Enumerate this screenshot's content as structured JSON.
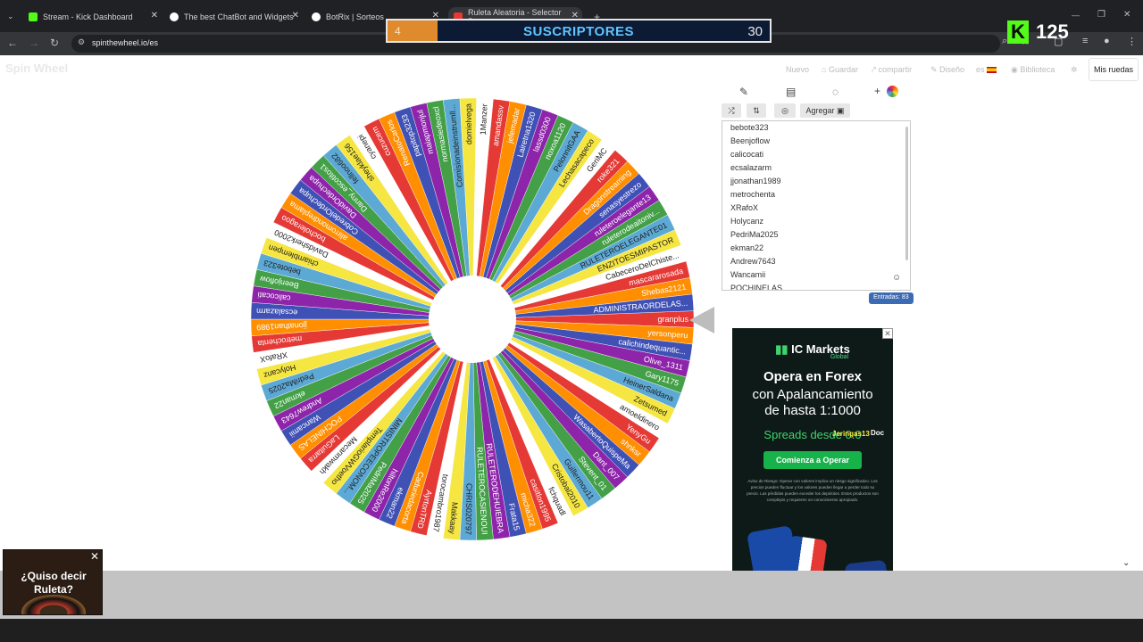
{
  "tabs": [
    {
      "title": "Stream - Kick Dashboard",
      "color": "#53fc18"
    },
    {
      "title": "The best ChatBot and Widgets",
      "color": "#ffffff"
    },
    {
      "title": "BotRix | Sorteos",
      "color": "#ffffff"
    },
    {
      "title": "Ruleta Aleatoria - Selector Per...",
      "color": "#e53935"
    }
  ],
  "url": "spinthewheel.io/es",
  "overlay": {
    "subs_current": "4",
    "subs_label": "SUSCRIPTORES",
    "subs_goal": "30",
    "subs_progress": 0.13,
    "kick_logo": "K",
    "kick_count": "125"
  },
  "site": {
    "logo": "Spin Wheel",
    "menu": [
      "Nuevo",
      "Guardar",
      "compartir",
      "Diseño",
      "es",
      "Biblioteca"
    ],
    "mis_ruedas": "Mis ruedas"
  },
  "panel": {
    "agregar": "Agregar",
    "entries_badge": "Entradas: 83",
    "entries": [
      "bebote323",
      "Beenjoflow",
      "calicocati",
      "ecsalazarm",
      "jjonathan1989",
      "metrochenta",
      "XRafoX",
      "Holycanz",
      "PedriMa2025",
      "ekman22",
      "Andrew7643",
      "Wancamii",
      "POCHINELAS"
    ]
  },
  "wheel": {
    "colors": [
      "#e53935",
      "#ff8f00",
      "#3f51b5",
      "#8e24aa",
      "#43a047",
      "#5da9d6",
      "#f5e642",
      "#ffffff"
    ],
    "names": [
      "granplus",
      "yersonperu",
      "calichindequantic...",
      "Olive_1311",
      "Gary1175",
      "HeinerSaldana",
      "Zetsumed",
      "amoeldinero",
      "YenyGu",
      "shnksr",
      "WasabertoQuispeMa",
      "Dant_007",
      "Stevent_01",
      "Guillermou11",
      "Cristobal2010",
      "fchquadl",
      "casitlon1995",
      "micha322",
      "Frata15",
      "RULETERODEHUIEBRA",
      "RULETEROCASIENOUI",
      "CHRIS020797",
      "Makkaay",
      "torocambro1987",
      "AyrtonTRD",
      "Caduriedacorta",
      "ekman22",
      "hiltonRe2000",
      "PedriMa2025",
      "MINISTROPEECONOM...",
      "TemplarioGWVoetho",
      "Mecanmwakh",
      "LaGuitarra",
      "POCHINELAS",
      "Wancamii",
      "Andrew7643",
      "ekman22",
      "PedriMa2025",
      "Holycanz",
      "XRafoX",
      "metrochenta",
      "jjonathan1989",
      "ecsalazarm",
      "calicocati",
      "Beenjoflow",
      "bebote323",
      "chiamblempen",
      "Davidsherk2000",
      "bocholeragoo",
      "alirromondreplama",
      "CobredelOrdechupa",
      "DavidOrdechupa",
      "Danny_escotitos1",
      "fellnoo682",
      "sheyklae156",
      "cyanepi",
      "cuzucem",
      "RenatoCarlos",
      "papitop3233",
      "maiapmonjul",
      "normasiedeoxcl",
      "Comisionadeinstrumll...",
      "domielvega",
      "1Manzer",
      "amandassv",
      "jefemadar",
      "Lairetna1320",
      "lassd0300",
      "noxoa1120",
      "PelonnitGAA",
      "Lechasacapeco",
      "GeriMC",
      "roke321",
      "Dragonstreaming",
      "senasyestrezo",
      "ruleteroelegante13",
      "ruleterodeaitoniv...",
      "RULETEROELEGANTE01",
      "ENZITOESMIPASTOR",
      "CabeceroDelChiste...",
      "mascararosada",
      "Shebas2121",
      "ADMINISTRAORDELAS..."
    ]
  },
  "ad": {
    "brand": "IC Markets",
    "brand_sub": "Global",
    "line1": "Opera en Forex",
    "line2": "con Apalancamiento",
    "line3": "de hasta 1:1000",
    "spreads": "Spreads desde 0.0",
    "cta": "Comienza a Operar",
    "risk": "Aviso de Riesgo: Operar con valores implica un riesgo significativo. Los precios pueden fluctuar y los valores pueden llegar a perder todo su precio. Las pérdidas pueden exceder los depósitos. Estos productos son complejos y requieren un conocimiento apropiado.",
    "overlay_a": "Jeringas13",
    "overlay_b": "Doc"
  },
  "popup": {
    "text": "¿Quiso decir Ruleta?"
  }
}
